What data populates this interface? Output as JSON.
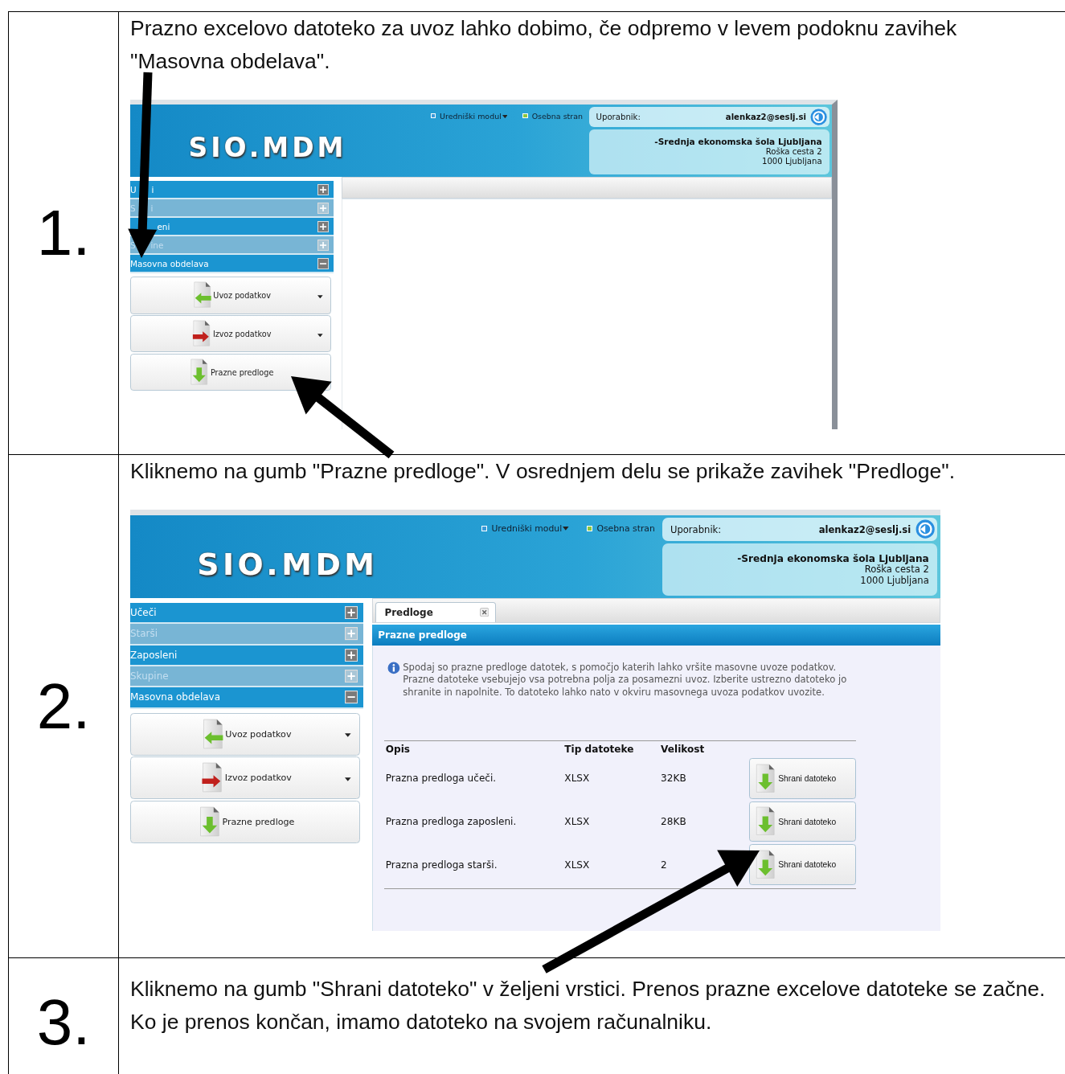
{
  "steps": [
    {
      "number": "1.",
      "text": "Prazno excelovo datoteko za uvoz lahko dobimo, če odpremo v levem podoknu zavihek \"Masovna obdelava\".",
      "screen": {
        "header": {
          "logo": "SIO.MDM",
          "nav": [
            {
              "label": "Uredniški modul",
              "color": "#3a9ad9",
              "dropdown": true
            },
            {
              "label": "Osebna stran",
              "color": "#8cc63f",
              "dropdown": false
            }
          ],
          "user_label": "Uporabnik:",
          "user": "alenkaz2@seslj.si",
          "school": "-Srednja ekonomska šola Ljubljana",
          "address": [
            "Roška cesta 2",
            "1000 Ljubljana"
          ]
        },
        "sidebar": {
          "items": [
            {
              "before": "U",
              "after": "i",
              "disabled": false,
              "expanded": false
            },
            {
              "before": "S",
              "after": "i",
              "disabled": true,
              "expanded": false
            },
            {
              "after": "eni",
              "disabled": false,
              "expanded": false
            },
            {
              "before": "S",
              "after": "ine",
              "disabled": true,
              "expanded": false
            },
            {
              "label": "Masovna obdelava",
              "disabled": false,
              "expanded": true
            }
          ],
          "buttons": [
            {
              "kind": "import",
              "label": "Uvoz podatkov",
              "dropdown": true
            },
            {
              "kind": "export",
              "label": "Izvoz podatkov",
              "dropdown": true
            },
            {
              "kind": "download",
              "label": "Prazne predloge",
              "dropdown": false
            }
          ]
        }
      }
    },
    {
      "number": "2.",
      "text": "Kliknemo na gumb \"Prazne predloge\". V osrednjem delu se prikaže zavihek \"Predloge\".",
      "screen": {
        "header": {
          "logo": "SIO.MDM",
          "nav": [
            {
              "label": "Uredniški modul",
              "color": "#3a9ad9",
              "dropdown": true
            },
            {
              "label": "Osebna stran",
              "color": "#8cc63f",
              "dropdown": false
            }
          ],
          "user_label": "Uporabnik:",
          "user": "alenkaz2@seslj.si",
          "school": "-Srednja ekonomska šola Ljubljana",
          "address": [
            "Roška cesta 2",
            "1000 Ljubljana"
          ]
        },
        "sidebar": {
          "items": [
            {
              "label": "Učeči",
              "disabled": false,
              "expanded": false
            },
            {
              "label": "Starši",
              "disabled": true,
              "expanded": false
            },
            {
              "label": "Zaposleni",
              "disabled": false,
              "expanded": false
            },
            {
              "label": "Skupine",
              "disabled": true,
              "expanded": false
            },
            {
              "label": "Masovna obdelava",
              "disabled": false,
              "expanded": true
            }
          ],
          "buttons": [
            {
              "kind": "import",
              "label": "Uvoz podatkov",
              "dropdown": true
            },
            {
              "kind": "export",
              "label": "Izvoz podatkov",
              "dropdown": true
            },
            {
              "kind": "download",
              "label": "Prazne predloge",
              "dropdown": false
            }
          ]
        },
        "main": {
          "tabs": [
            {
              "label": "Predloge",
              "selected": true
            }
          ],
          "panel": {
            "title": "Prazne predloge",
            "info": "Spodaj so prazne predloge datotek, s pomočjo katerih lahko vršite masovne uvoze podatkov. Prazne datoteke vsebujejo vsa potrebna polja za posamezni uvoz. Izberite ustrezno datoteko jo shranite in napolnite. To datoteko lahko nato v okviru masovnega uvoza podatkov uvozite.",
            "columns": [
              "Opis",
              "Tip datoteke",
              "Velikost"
            ],
            "rows": [
              {
                "description": "Prazna predloga učeči.",
                "type": "XLSX",
                "size": "32KB",
                "button": "Shrani datoteko"
              },
              {
                "description": "Prazna predloga zaposleni.",
                "type": "XLSX",
                "size": "28KB",
                "button": "Shrani datoteko"
              },
              {
                "description": "Prazna predloga starši.",
                "type": "XLSX",
                "size": "2",
                "button": "Shrani datoteko"
              }
            ]
          }
        }
      }
    },
    {
      "number": "3.",
      "text": "Kliknemo na gumb \"Shrani datoteko\" v željeni vrstici. Prenos prazne excelove datoteke se začne. Ko je prenos končan, imamo datoteko na svojem računalniku."
    }
  ]
}
